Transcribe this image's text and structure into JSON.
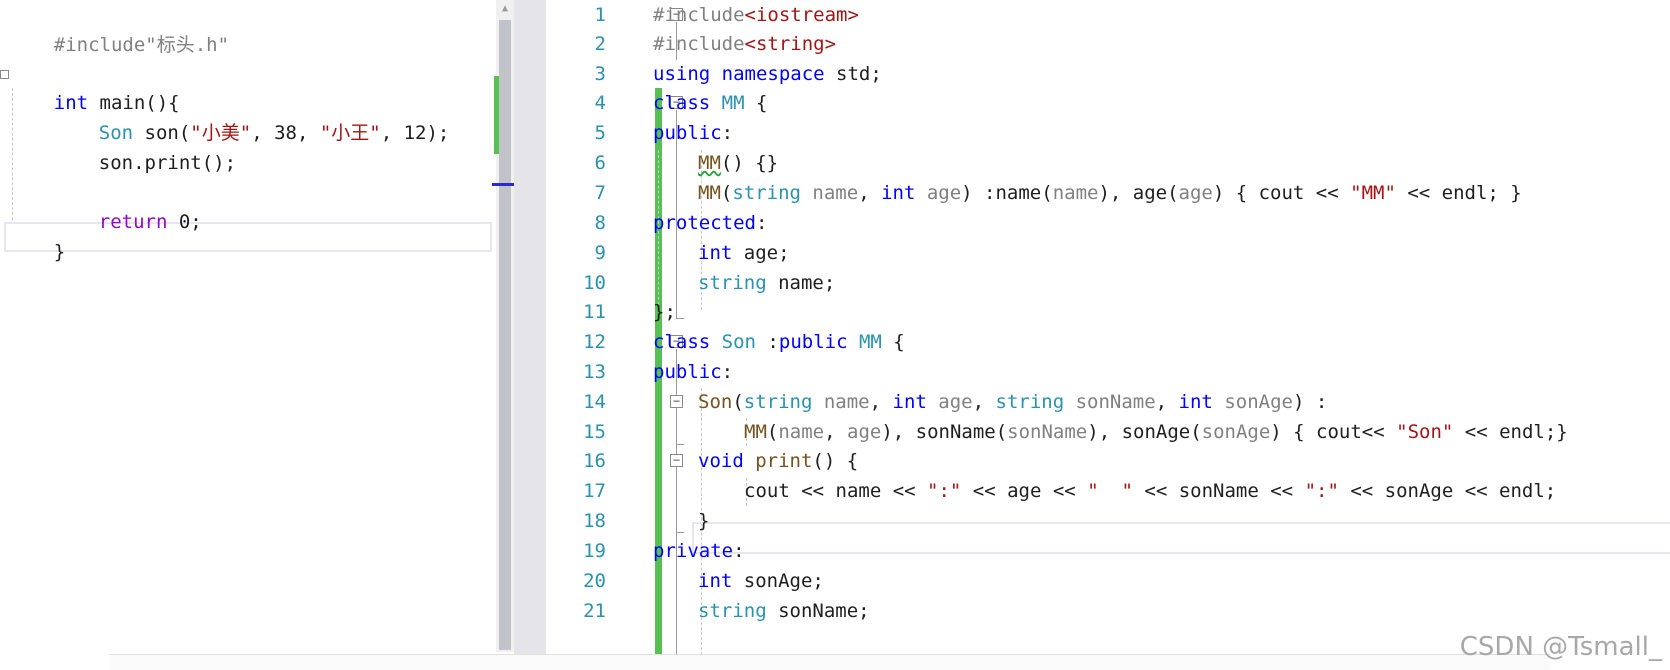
{
  "left_editor": {
    "include_line": "#include\"标头.h\"",
    "main_sig": {
      "kw_int": "int",
      "name": " main(){"
    },
    "son_decl": {
      "type": "Son",
      "rest1": " son(",
      "str1": "\"小美\"",
      "mid": ", 38, ",
      "str2": "\"小王\"",
      "tail": ", 12);"
    },
    "print_call": "son.print();",
    "return_kw": "return",
    "return_val": " 0;",
    "close_brace": "}"
  },
  "right_editor": {
    "line_numbers": [
      "1",
      "2",
      "3",
      "4",
      "5",
      "6",
      "7",
      "8",
      "9",
      "10",
      "11",
      "12",
      "13",
      "14",
      "15",
      "16",
      "17",
      "18",
      "19",
      "20",
      "21"
    ],
    "l1": {
      "pre": "#include",
      "hdr": "<iostream>"
    },
    "l2": {
      "pre": "#include",
      "hdr": "<string>"
    },
    "l3": {
      "kw1": "using",
      "kw2": "namespace",
      "rest": " std;"
    },
    "l4": {
      "kw": "class",
      "name": "MM",
      "rest": " {"
    },
    "l5": {
      "kw": "public",
      "rest": ":"
    },
    "l6": {
      "fn": "MM",
      "rest": "() {}"
    },
    "l7": {
      "fn": "MM",
      "p1": "(",
      "t1": "string",
      "n1": " name",
      "c1": ", ",
      "t2": "int",
      "n2": " age",
      "init": ") :name(",
      "a1": "name",
      "m1": "), age(",
      "a2": "age",
      "body": ") { cout << ",
      "s": "\"MM\"",
      "end": " << endl; }"
    },
    "l8": {
      "kw": "protected",
      "rest": ":"
    },
    "l9": {
      "kw": "int",
      "rest": " age;"
    },
    "l10": {
      "typ": "string",
      "rest": " name;"
    },
    "l11": {
      "text": "};"
    },
    "l12": {
      "kw": "class",
      "name": "Son",
      "mid": " :",
      "kw2": "public",
      "base": "MM",
      "rest": " {"
    },
    "l13": {
      "kw": "public",
      "rest": ":"
    },
    "l14": {
      "fn": "Son",
      "p": "(",
      "t1": "string",
      "n1": " name",
      "c1": ", ",
      "t2": "int",
      "n2": " age",
      "c2": ", ",
      "t3": "string",
      "n3": " sonName",
      "c3": ", ",
      "t4": "int",
      "n4": " sonAge",
      "end": ") :"
    },
    "l15": {
      "fn": "MM",
      "a": "(",
      "p1": "name",
      "c1": ", ",
      "p2": "age",
      "m": "), sonName(",
      "p3": "sonName",
      "m2": "), sonAge(",
      "p4": "sonAge",
      "body": ") { cout<< ",
      "s": "\"Son\"",
      "end": " << endl;}"
    },
    "l16": {
      "kw": "void",
      "fn": " print",
      "rest": "() {"
    },
    "l17": {
      "a": "cout << name << ",
      "s1": "\":\"",
      "b": " << age << ",
      "s2": "\"  \"",
      "c": " << sonName << ",
      "s3": "\":\"",
      "d": " << sonAge << endl;"
    },
    "l18": {
      "text": "}"
    },
    "l19": {
      "kw": "private",
      "rest": ":"
    },
    "l20": {
      "kw": "int",
      "rest": " sonAge;"
    },
    "l21": {
      "typ": "string",
      "rest": " sonName;"
    }
  },
  "watermark": "CSDN @Tsmall_",
  "colors": {
    "keyword": "#0000ff",
    "type": "#2b91af",
    "string": "#a31515",
    "preprocessor": "#808080",
    "control": "#8f08c4",
    "function": "#74531f",
    "change_bar": "#57c054"
  }
}
